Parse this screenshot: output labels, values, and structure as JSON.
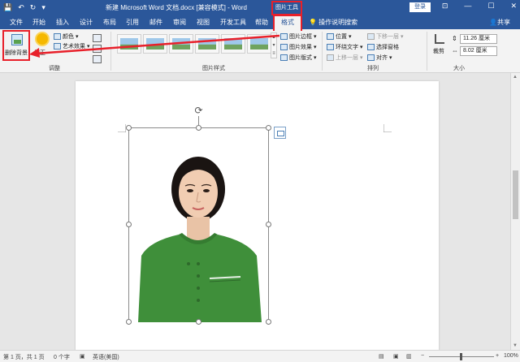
{
  "titlebar": {
    "doc_title": "新建 Microsoft Word 文档.docx [兼容模式] - Word",
    "picture_tools": "图片工具",
    "login": "登录",
    "qat_save": "💾",
    "qat_undo": "↶",
    "qat_redo": "↻",
    "qat_more": "▾",
    "win_ribbon_opts": "⊡",
    "win_min": "—",
    "win_max": "☐",
    "win_close": "✕"
  },
  "tabs": {
    "file": "文件",
    "home": "开始",
    "insert": "插入",
    "design": "设计",
    "layout": "布局",
    "references": "引用",
    "mailings": "邮件",
    "review": "审阅",
    "view": "视图",
    "developer": "开发工具",
    "help": "帮助",
    "format": "格式",
    "tell_me": "操作说明搜索",
    "share": "共享"
  },
  "ribbon": {
    "adjust": {
      "remove_background": "删除背景",
      "corrections": "校正",
      "color": "颜色",
      "artistic_effects": "艺术效果",
      "group_label": "调整"
    },
    "picture_styles": {
      "picture_border": "图片边框",
      "picture_effects": "图片效果",
      "picture_layout": "图片版式",
      "group_label": "图片样式"
    },
    "arrange": {
      "position": "位置",
      "wrap_text": "环绕文字",
      "bring_forward": "上移一层",
      "send_backward": "下移一层",
      "selection_pane": "选择窗格",
      "align": "对齐",
      "group_label": "排列"
    },
    "size": {
      "crop": "裁剪",
      "height": "11.26 厘米",
      "width": "8.02 厘米",
      "group_label": "大小"
    }
  },
  "statusbar": {
    "page": "第 1 页，共 1 页",
    "words": "0 个字",
    "language": "英语(美国)",
    "zoom": "100%"
  },
  "colors": {
    "title_blue": "#2b579a",
    "highlight_red": "#e8202a",
    "shirt_green": "#3f8f3a"
  }
}
